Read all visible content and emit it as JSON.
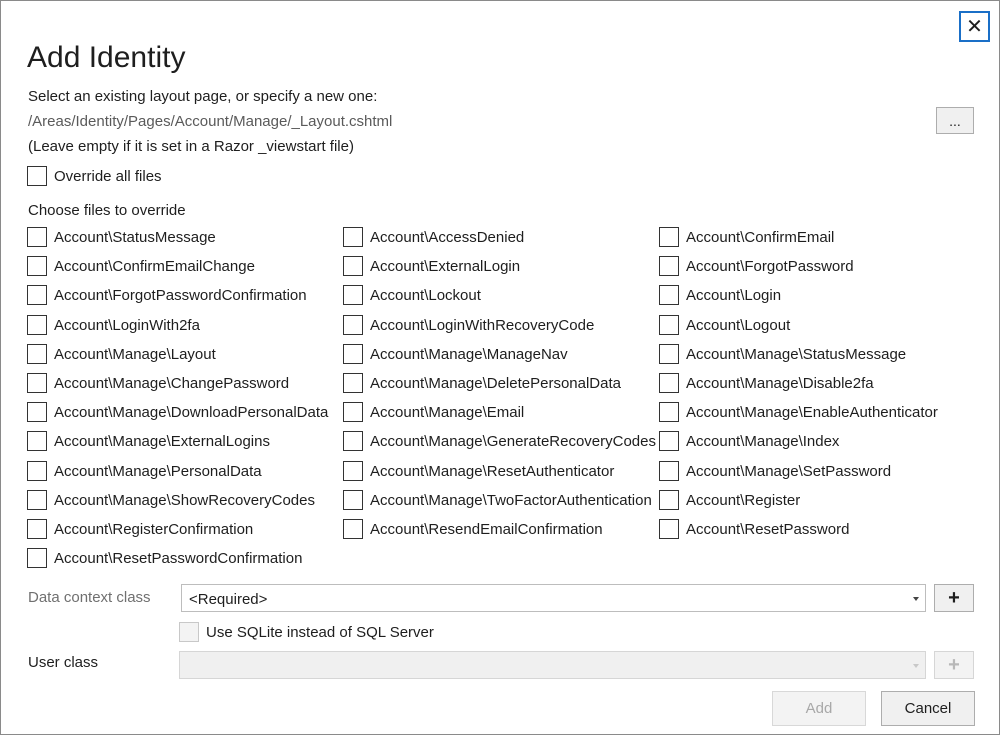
{
  "dialog": {
    "title": "Add Identity",
    "close_icon": "close-icon"
  },
  "layout": {
    "prompt": "Select an existing layout page, or specify a new one:",
    "path": "/Areas/Identity/Pages/Account/Manage/_Layout.cshtml",
    "browse_label": "...",
    "hint": "(Leave empty if it is set in a Razor _viewstart file)"
  },
  "override_all": {
    "label": "Override all files",
    "checked": false
  },
  "files": {
    "heading": "Choose files to override",
    "col1": [
      "Account\\StatusMessage",
      "Account\\ConfirmEmailChange",
      "Account\\ForgotPasswordConfirmation",
      "Account\\LoginWith2fa",
      "Account\\Manage\\Layout",
      "Account\\Manage\\ChangePassword",
      "Account\\Manage\\DownloadPersonalData",
      "Account\\Manage\\ExternalLogins",
      "Account\\Manage\\PersonalData",
      "Account\\Manage\\ShowRecoveryCodes",
      "Account\\RegisterConfirmation",
      "Account\\ResetPasswordConfirmation"
    ],
    "col2": [
      "Account\\AccessDenied",
      "Account\\ExternalLogin",
      "Account\\Lockout",
      "Account\\LoginWithRecoveryCode",
      "Account\\Manage\\ManageNav",
      "Account\\Manage\\DeletePersonalData",
      "Account\\Manage\\Email",
      "Account\\Manage\\GenerateRecoveryCodes",
      "Account\\Manage\\ResetAuthenticator",
      "Account\\Manage\\TwoFactorAuthentication",
      "Account\\ResendEmailConfirmation"
    ],
    "col3": [
      "Account\\ConfirmEmail",
      "Account\\ForgotPassword",
      "Account\\Login",
      "Account\\Logout",
      "Account\\Manage\\StatusMessage",
      "Account\\Manage\\Disable2fa",
      "Account\\Manage\\EnableAuthenticator",
      "Account\\Manage\\Index",
      "Account\\Manage\\SetPassword",
      "Account\\Register",
      "Account\\ResetPassword"
    ]
  },
  "data_context": {
    "label": "Data context class",
    "value": "<Required>",
    "add_label": "+"
  },
  "sqlite": {
    "label": "Use SQLite instead of SQL Server",
    "checked": false,
    "enabled": false
  },
  "user_class": {
    "label": "User class",
    "value": "",
    "add_label": "+"
  },
  "buttons": {
    "add": "Add",
    "cancel": "Cancel"
  }
}
